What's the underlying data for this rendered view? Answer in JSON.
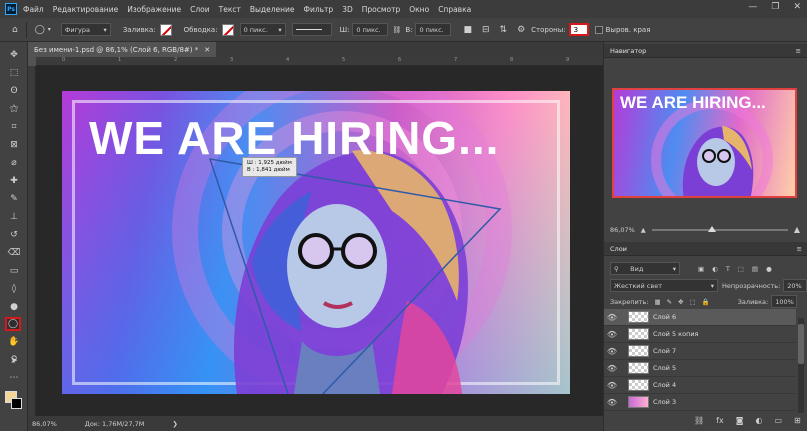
{
  "app": {
    "logo": "Ps",
    "menu": [
      "Файл",
      "Редактирование",
      "Изображение",
      "Слои",
      "Текст",
      "Выделение",
      "Фильтр",
      "3D",
      "Просмотр",
      "Окно",
      "Справка"
    ],
    "window_controls": [
      "—",
      "❐",
      "✕"
    ]
  },
  "options": {
    "mode": "Фигура",
    "fill_label": "Заливка:",
    "stroke_label": "Обводка:",
    "stroke_width": "0 пикс.",
    "w_label": "Ш:",
    "w_value": "0 пикс.",
    "h_label": "В:",
    "h_value": "0 пикс.",
    "sides_label": "Стороны:",
    "sides_value": "3",
    "align_edges_label": "Выров. края"
  },
  "document": {
    "tab_title": "Без имени-1.psd @ 86,1% (Слой 6, RGB/8#) *",
    "tab_close": "✕",
    "headline": "WE ARE HIRING...",
    "tooltip_w": "Ш :  1,925 дюйм",
    "tooltip_h": "В :  1,841 дюйм",
    "status_zoom": "86,07%",
    "status_doc": "Док: 1,76M/27,7M",
    "status_arrow": "❯",
    "ruler_ticks": [
      "0",
      "1",
      "2",
      "3",
      "4",
      "5",
      "6",
      "7",
      "8",
      "9"
    ]
  },
  "navigator": {
    "title": "Навигатор",
    "thumb_text": "WE ARE HIRING...",
    "zoom": "86,07%"
  },
  "layers_panel": {
    "title": "Слои",
    "filter": "Вид",
    "blend_mode": "Жесткий свет",
    "opacity_label": "Непрозрачность:",
    "opacity_value": "20%",
    "lock_label": "Закрепить:",
    "fill_label": "Заливка:",
    "fill_value": "100%",
    "layers": [
      {
        "name": "Слой 6",
        "selected": true
      },
      {
        "name": "Слой 5 копия",
        "selected": false
      },
      {
        "name": "Слой 7",
        "selected": false
      },
      {
        "name": "Слой 5",
        "selected": false
      },
      {
        "name": "Слой 4",
        "selected": false
      },
      {
        "name": "Слой 3",
        "selected": false
      }
    ]
  },
  "colors": {
    "accent_red": "#d7191c",
    "foreground_swatch": "#f2d59a",
    "background_swatch": "#000000"
  }
}
